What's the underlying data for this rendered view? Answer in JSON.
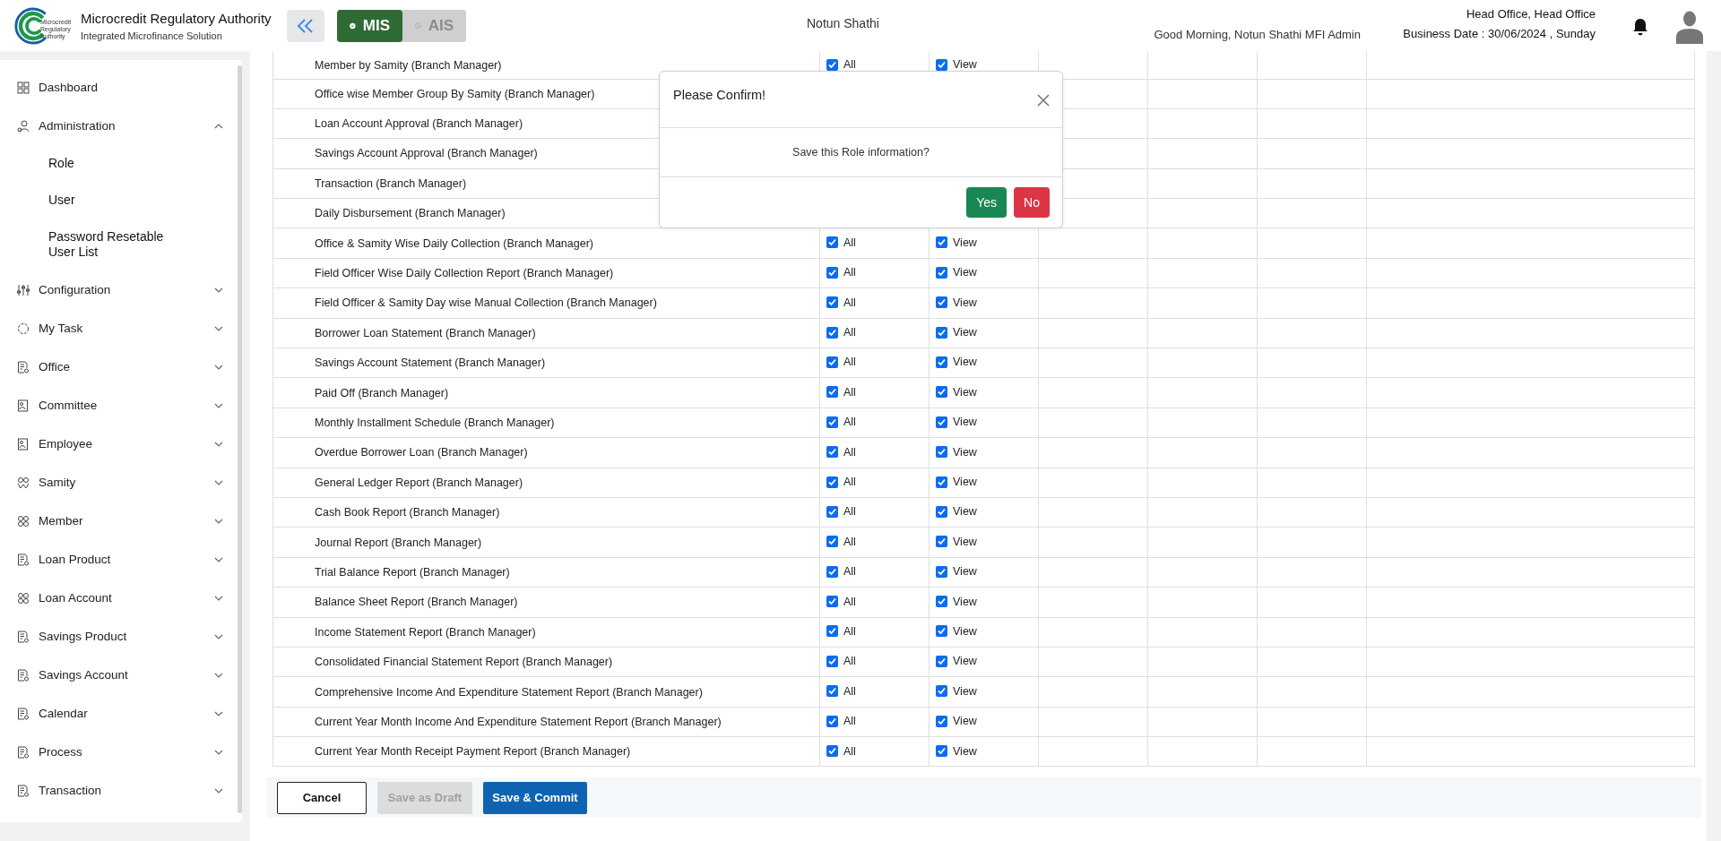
{
  "header": {
    "org_title": "Microcredit Regulatory Authority",
    "org_subtitle": "Integrated Microfinance Solution",
    "logo_text": [
      "Microcredit",
      "Regulatory",
      "Authority"
    ],
    "modules": [
      {
        "label": "MIS",
        "selected": true
      },
      {
        "label": "AIS",
        "selected": false
      }
    ],
    "org_name": "Notun Shathi",
    "greeting": "Good Morning, Notun Shathi MFI Admin",
    "office": "Head Office, Head Office",
    "business_date": "Business Date : 30/06/2024 , Sunday"
  },
  "sidebar": {
    "items": [
      {
        "label": "Dashboard"
      },
      {
        "label": "Administration",
        "expanded": true,
        "children": [
          {
            "label": "Role"
          },
          {
            "label": "User"
          },
          {
            "label": "Password Resetable User List"
          }
        ]
      },
      {
        "label": "Configuration",
        "expanded": false
      },
      {
        "label": "My Task",
        "expanded": false
      },
      {
        "label": "Office",
        "expanded": false
      },
      {
        "label": "Committee",
        "expanded": false
      },
      {
        "label": "Employee",
        "expanded": false
      },
      {
        "label": "Samity",
        "expanded": false
      },
      {
        "label": "Member",
        "expanded": false
      },
      {
        "label": "Loan Product",
        "expanded": false
      },
      {
        "label": "Loan Account",
        "expanded": false
      },
      {
        "label": "Savings Product",
        "expanded": false
      },
      {
        "label": "Savings Account",
        "expanded": false
      },
      {
        "label": "Calendar",
        "expanded": false
      },
      {
        "label": "Process",
        "expanded": false
      },
      {
        "label": "Transaction",
        "expanded": false
      }
    ]
  },
  "table": {
    "rows": [
      {
        "name": "Member by Samity (Branch Manager)",
        "all": {
          "label": "All",
          "checked": true
        },
        "view": {
          "label": "View",
          "checked": true
        }
      },
      {
        "name": "Office wise Member Group By Samity (Branch Manager)"
      },
      {
        "name": "Loan Account Approval (Branch Manager)"
      },
      {
        "name": "Savings Account Approval (Branch Manager)"
      },
      {
        "name": "Transaction (Branch Manager)"
      },
      {
        "name": "Daily Disbursement (Branch Manager)"
      },
      {
        "name": "Office & Samity Wise Daily Collection (Branch Manager)",
        "all": {
          "label": "All",
          "checked": true
        },
        "view": {
          "label": "View",
          "checked": true
        }
      },
      {
        "name": "Field Officer Wise Daily Collection Report (Branch Manager)",
        "all": {
          "label": "All",
          "checked": true
        },
        "view": {
          "label": "View",
          "checked": true
        }
      },
      {
        "name": "Field Officer & Samity Day wise Manual Collection (Branch Manager)",
        "all": {
          "label": "All",
          "checked": true
        },
        "view": {
          "label": "View",
          "checked": true
        }
      },
      {
        "name": "Borrower Loan Statement (Branch Manager)",
        "all": {
          "label": "All",
          "checked": true
        },
        "view": {
          "label": "View",
          "checked": true
        }
      },
      {
        "name": "Savings Account Statement (Branch Manager)",
        "all": {
          "label": "All",
          "checked": true
        },
        "view": {
          "label": "View",
          "checked": true
        }
      },
      {
        "name": "Paid Off (Branch Manager)",
        "all": {
          "label": "All",
          "checked": true
        },
        "view": {
          "label": "View",
          "checked": true
        }
      },
      {
        "name": "Monthly Installment Schedule (Branch Manager)",
        "all": {
          "label": "All",
          "checked": true
        },
        "view": {
          "label": "View",
          "checked": true
        }
      },
      {
        "name": "Overdue Borrower Loan (Branch Manager)",
        "all": {
          "label": "All",
          "checked": true
        },
        "view": {
          "label": "View",
          "checked": true
        }
      },
      {
        "name": "General Ledger Report (Branch Manager)",
        "all": {
          "label": "All",
          "checked": true
        },
        "view": {
          "label": "View",
          "checked": true
        }
      },
      {
        "name": "Cash Book Report (Branch Manager)",
        "all": {
          "label": "All",
          "checked": true
        },
        "view": {
          "label": "View",
          "checked": true
        }
      },
      {
        "name": "Journal Report (Branch Manager)",
        "all": {
          "label": "All",
          "checked": true
        },
        "view": {
          "label": "View",
          "checked": true
        }
      },
      {
        "name": "Trial Balance Report (Branch Manager)",
        "all": {
          "label": "All",
          "checked": true
        },
        "view": {
          "label": "View",
          "checked": true
        }
      },
      {
        "name": "Balance Sheet Report (Branch Manager)",
        "all": {
          "label": "All",
          "checked": true
        },
        "view": {
          "label": "View",
          "checked": true
        }
      },
      {
        "name": "Income Statement Report (Branch Manager)",
        "all": {
          "label": "All",
          "checked": true
        },
        "view": {
          "label": "View",
          "checked": true
        }
      },
      {
        "name": "Consolidated Financial Statement Report (Branch Manager)",
        "all": {
          "label": "All",
          "checked": true
        },
        "view": {
          "label": "View",
          "checked": true
        }
      },
      {
        "name": "Comprehensive Income And Expenditure Statement Report (Branch Manager)",
        "all": {
          "label": "All",
          "checked": true
        },
        "view": {
          "label": "View",
          "checked": true
        }
      },
      {
        "name": "Current Year Month Income And Expenditure Statement Report (Branch Manager)",
        "all": {
          "label": "All",
          "checked": true
        },
        "view": {
          "label": "View",
          "checked": true
        }
      },
      {
        "name": "Current Year Month Receipt Payment Report (Branch Manager)",
        "all": {
          "label": "All",
          "checked": true
        },
        "view": {
          "label": "View",
          "checked": true
        }
      }
    ]
  },
  "actions": [
    {
      "label": "Cancel",
      "kind": "outline",
      "disabled": false
    },
    {
      "label": "Save as Draft",
      "kind": "secondary",
      "disabled": true
    },
    {
      "label": "Save & Commit",
      "kind": "primary",
      "disabled": false
    }
  ],
  "dialog": {
    "title": "Please Confirm!",
    "message": "Save this Role information?",
    "buttons": [
      {
        "label": "Yes",
        "kind": "confirm"
      },
      {
        "label": "No",
        "kind": "cancel"
      }
    ]
  }
}
